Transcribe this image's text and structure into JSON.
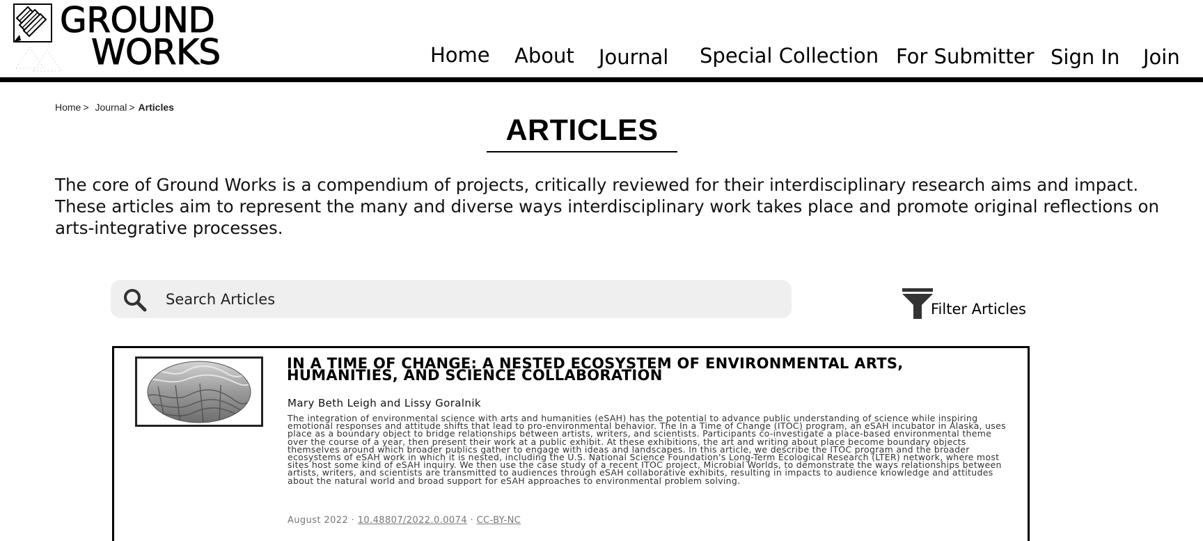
{
  "logo": {
    "line1": "GROUND",
    "line2": "WORKS",
    "icon": "pencils-logo-icon"
  },
  "nav": {
    "items": [
      {
        "label": "Home"
      },
      {
        "label": "About"
      },
      {
        "label": "Journal"
      },
      {
        "label": "Special Collection"
      },
      {
        "label": "For Submitter"
      },
      {
        "label": "Sign In"
      },
      {
        "label": "Join"
      }
    ]
  },
  "breadcrumb": {
    "home": "Home",
    "journal": "Journal",
    "current": "Articles",
    "separator": ">"
  },
  "page": {
    "title": "ARTICLES",
    "intro": "The core of Ground Works is a compendium of projects, critically reviewed for their interdisciplinary research aims and impact. These articles aim to represent the many and diverse ways interdisciplinary work takes place and promote original reflections on arts-integrative processes."
  },
  "search": {
    "placeholder": "Search Articles",
    "value": "",
    "icon": "search-icon"
  },
  "filter": {
    "label": "Filter Articles",
    "icon": "filter-icon"
  },
  "articles": [
    {
      "title": "In a Time of Change: A Nested Ecosystem of Environmental Arts, Humanities, and Science Collaboration",
      "authors": "Mary Beth Leigh and Lissy Goralnik",
      "abstract": "The integration of environmental science with arts and humanities (eSAH) has the potential to advance public understanding of science while inspiring emotional responses and attitude shifts that lead to pro-environmental behavior. The In a Time of Change (ITOC) program, an eSAH incubator in Alaska, uses place as a boundary object to bridge relationships between artists, writers, and scientists. Participants co-investigate a place-based environmental theme over the course of a year, then present their work at a public exhibit. At these exhibitions, the art and writing about place become boundary objects themselves around which broader publics gather to engage with ideas and landscapes. In this article, we describe the ITOC program and the broader ecosystems of eSAH work in which it is nested, including the U.S. National Science Foundation's Long-Term Ecological Research (LTER) network, where most sites host some kind of eSAH inquiry. We then use the case study of a recent ITOC project, Microbial Worlds, to demonstrate the ways relationships between artists, writers, and scientists are transmitted to audiences through eSAH collaborative exhibits, resulting in impacts to audience knowledge and attitudes about the natural world and broad support for eSAH approaches to environmental problem solving.",
      "date": "August 2022",
      "doi": "10.48807/2022.0.0074",
      "license": "CC-BY-NC",
      "meta_separator": "·"
    }
  ]
}
